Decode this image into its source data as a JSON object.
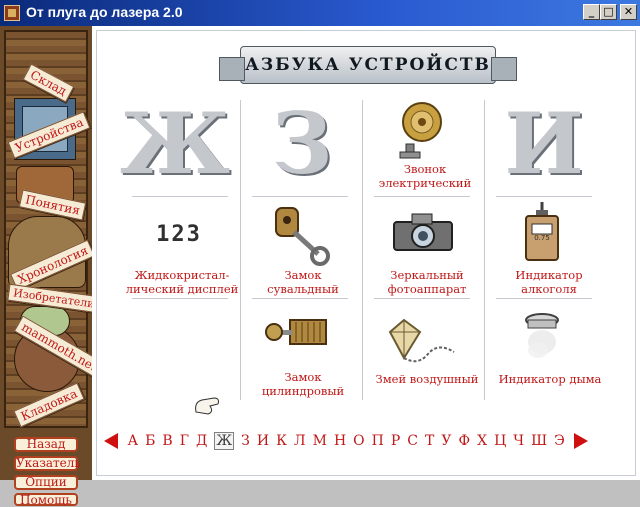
{
  "window": {
    "title": "От плуга до лазера 2.0",
    "controls": {
      "minimize": "_",
      "maximize": "□",
      "close": "✕"
    }
  },
  "sidebar": {
    "tags": {
      "sklad": "Склад",
      "ustroistva": "Устройства",
      "ponyatiya": "Понятия",
      "hronologiya": "Хронология",
      "izobretateli": "Изобретатели",
      "mammoth": "mammoth.net",
      "kladovka": "Кладовка"
    },
    "buttons": {
      "back": "Назад",
      "index": "Указатель",
      "options": "Опции",
      "help": "Помощь"
    }
  },
  "main": {
    "banner": "АЗБУКА УСТРОЙСТВ",
    "big_letters": {
      "zh": "Ж",
      "z": "З",
      "i": "И"
    },
    "items": {
      "zvonok": "Звонок\nэлектрический",
      "lcd": "Жидкокристал-\nлический дисплей",
      "lcd_digits": "123",
      "zamok_suv": "Замок сувальдный",
      "zerkalny": "Зеркальный\nфотоаппарат",
      "indikator_alk": "Индикатор\nалкоголя",
      "alk_reading": "0.75",
      "zamok_cil": "Замок\nцилиндровый",
      "zmei": "Змей воздушный",
      "indikator_dym": "Индикатор дыма"
    }
  },
  "alphabet": {
    "letters": [
      "А",
      "Б",
      "В",
      "Г",
      "Д",
      "Ж",
      "З",
      "И",
      "К",
      "Л",
      "М",
      "Н",
      "О",
      "П",
      "Р",
      "С",
      "Т",
      "У",
      "Ф",
      "Х",
      "Ц",
      "Ч",
      "Ш",
      "Э"
    ],
    "selected": "Ж"
  },
  "colors": {
    "accent_red": "#c01818",
    "title_blue": "#0a2a7a",
    "big_letter_gray": "#c4c8cc"
  },
  "icons": {
    "bell": "electric-bell-icon",
    "lcd": "lcd-display-icon",
    "lever_lock": "lever-lock-key-icon",
    "camera": "slr-camera-icon",
    "alcohol": "alcohol-indicator-icon",
    "cylinder_lock": "cylinder-lock-icon",
    "kite": "kite-icon",
    "smoke": "smoke-detector-icon"
  }
}
